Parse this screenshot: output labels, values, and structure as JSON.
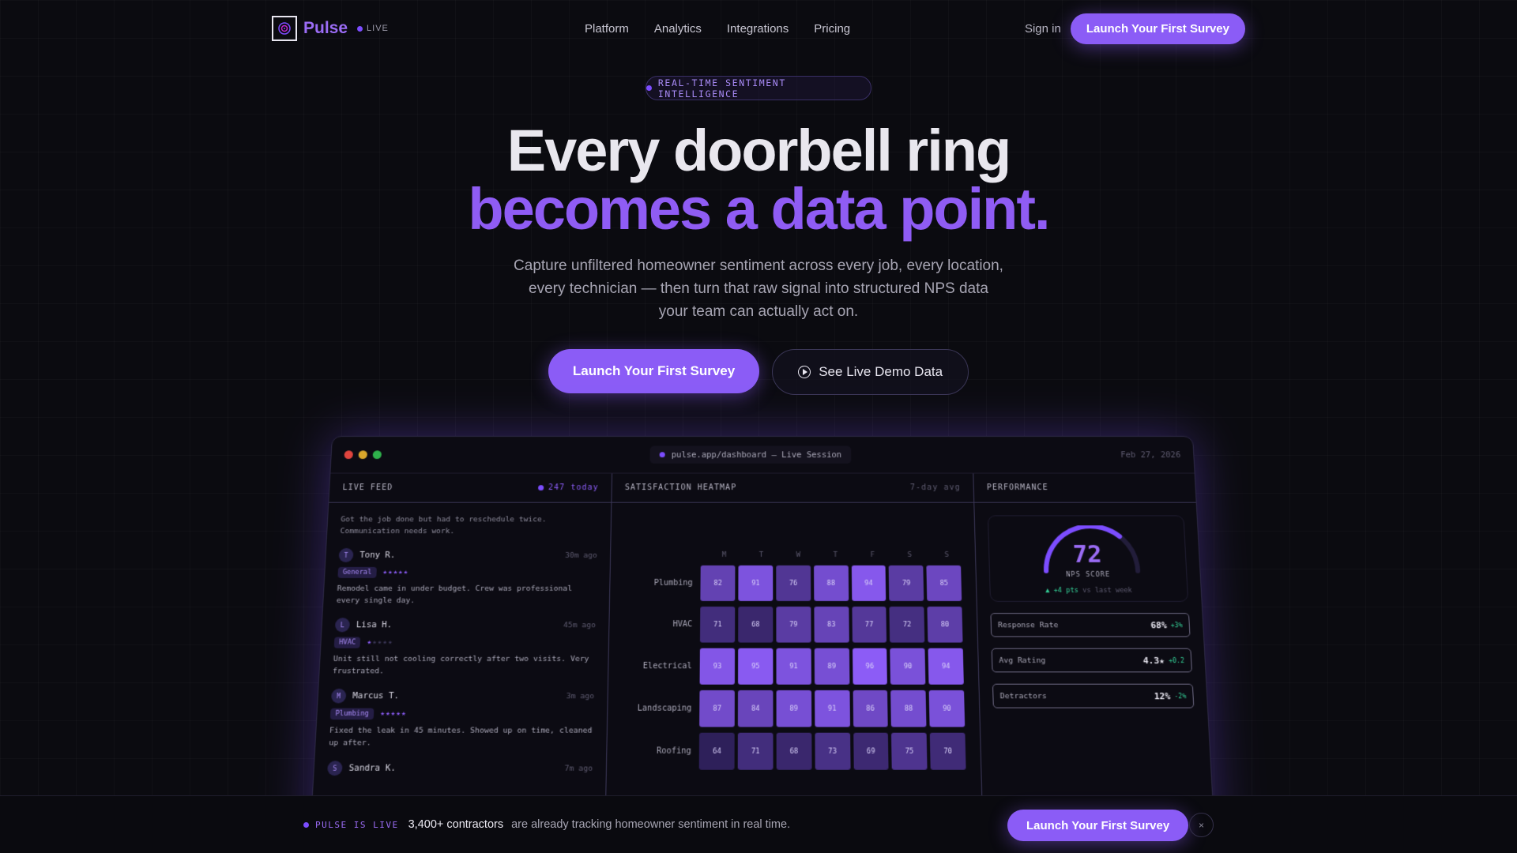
{
  "nav": {
    "brand": "Pulse",
    "live_label": "LIVE",
    "links": [
      "Platform",
      "Analytics",
      "Integrations",
      "Pricing"
    ],
    "signin": "Sign in",
    "cta": "Launch Your First Survey"
  },
  "hero": {
    "badge": "REAL-TIME SENTIMENT INTELLIGENCE",
    "headline_1": "Every doorbell ring",
    "headline_2": "becomes a data point.",
    "subtitle": "Capture unfiltered homeowner sentiment across every job, every location, every technician — then turn that raw signal into structured NPS data your team can actually act on.",
    "cta_primary": "Launch Your First Survey",
    "cta_secondary": "See Live Demo Data"
  },
  "dashboard": {
    "url": "pulse.app/dashboard — Live Session",
    "date": "Feb 27, 2026",
    "feed": {
      "title": "LIVE FEED",
      "count": "247 today",
      "note": "Got the job done but had to reschedule twice. Communication needs work.",
      "items": [
        {
          "initial": "T",
          "name": "Tony R.",
          "time": "30m ago",
          "tag": "General",
          "stars": 5,
          "text": "Remodel came in under budget. Crew was professional every single day."
        },
        {
          "initial": "L",
          "name": "Lisa H.",
          "time": "45m ago",
          "tag": "HVAC",
          "stars": 1,
          "text": "Unit still not cooling correctly after two visits. Very frustrated."
        },
        {
          "initial": "M",
          "name": "Marcus T.",
          "time": "3m ago",
          "tag": "Plumbing",
          "stars": 5,
          "text": "Fixed the leak in 45 minutes. Showed up on time, cleaned up after."
        },
        {
          "initial": "S",
          "name": "Sandra K.",
          "time": "7m ago",
          "tag": "",
          "stars": 0,
          "text": ""
        }
      ]
    },
    "heatmap": {
      "title": "SATISFACTION HEATMAP",
      "period": "7-day avg",
      "days": [
        "M",
        "T",
        "W",
        "T",
        "F",
        "S",
        "S"
      ],
      "rows": [
        {
          "label": "Plumbing",
          "values": [
            82,
            91,
            76,
            88,
            94,
            79,
            85
          ]
        },
        {
          "label": "HVAC",
          "values": [
            71,
            68,
            79,
            83,
            77,
            72,
            80
          ]
        },
        {
          "label": "Electrical",
          "values": [
            93,
            95,
            91,
            89,
            96,
            90,
            94
          ]
        },
        {
          "label": "Landscaping",
          "values": [
            87,
            84,
            89,
            91,
            86,
            88,
            90
          ]
        },
        {
          "label": "Roofing",
          "values": [
            64,
            71,
            68,
            73,
            69,
            75,
            70
          ]
        }
      ]
    },
    "performance": {
      "title": "PERFORMANCE",
      "nps": "72",
      "nps_label": "NPS SCORE",
      "nps_fraction": 0.72,
      "delta": "▲ +4 pts",
      "delta_suffix": "vs last week",
      "metrics": [
        {
          "label": "Response Rate",
          "value": "68%",
          "change": "+3%"
        },
        {
          "label": "Avg Rating",
          "value": "4.3★",
          "change": "+0.2"
        },
        {
          "label": "Detractors",
          "value": "12%",
          "change": "-2%"
        }
      ]
    }
  },
  "bottom_bar": {
    "live": "PULSE IS LIVE",
    "strong": "3,400+ contractors",
    "text": "are already tracking homeowner sentiment in real time.",
    "cta": "Launch Your First Survey",
    "close": "×"
  },
  "colors": {
    "accent": "#8b5cf6",
    "positive": "#34d399",
    "background": "#0b0b10"
  },
  "icons": [
    "logo-mark-icon",
    "play-icon",
    "close-icon",
    "live-dot-icon"
  ]
}
